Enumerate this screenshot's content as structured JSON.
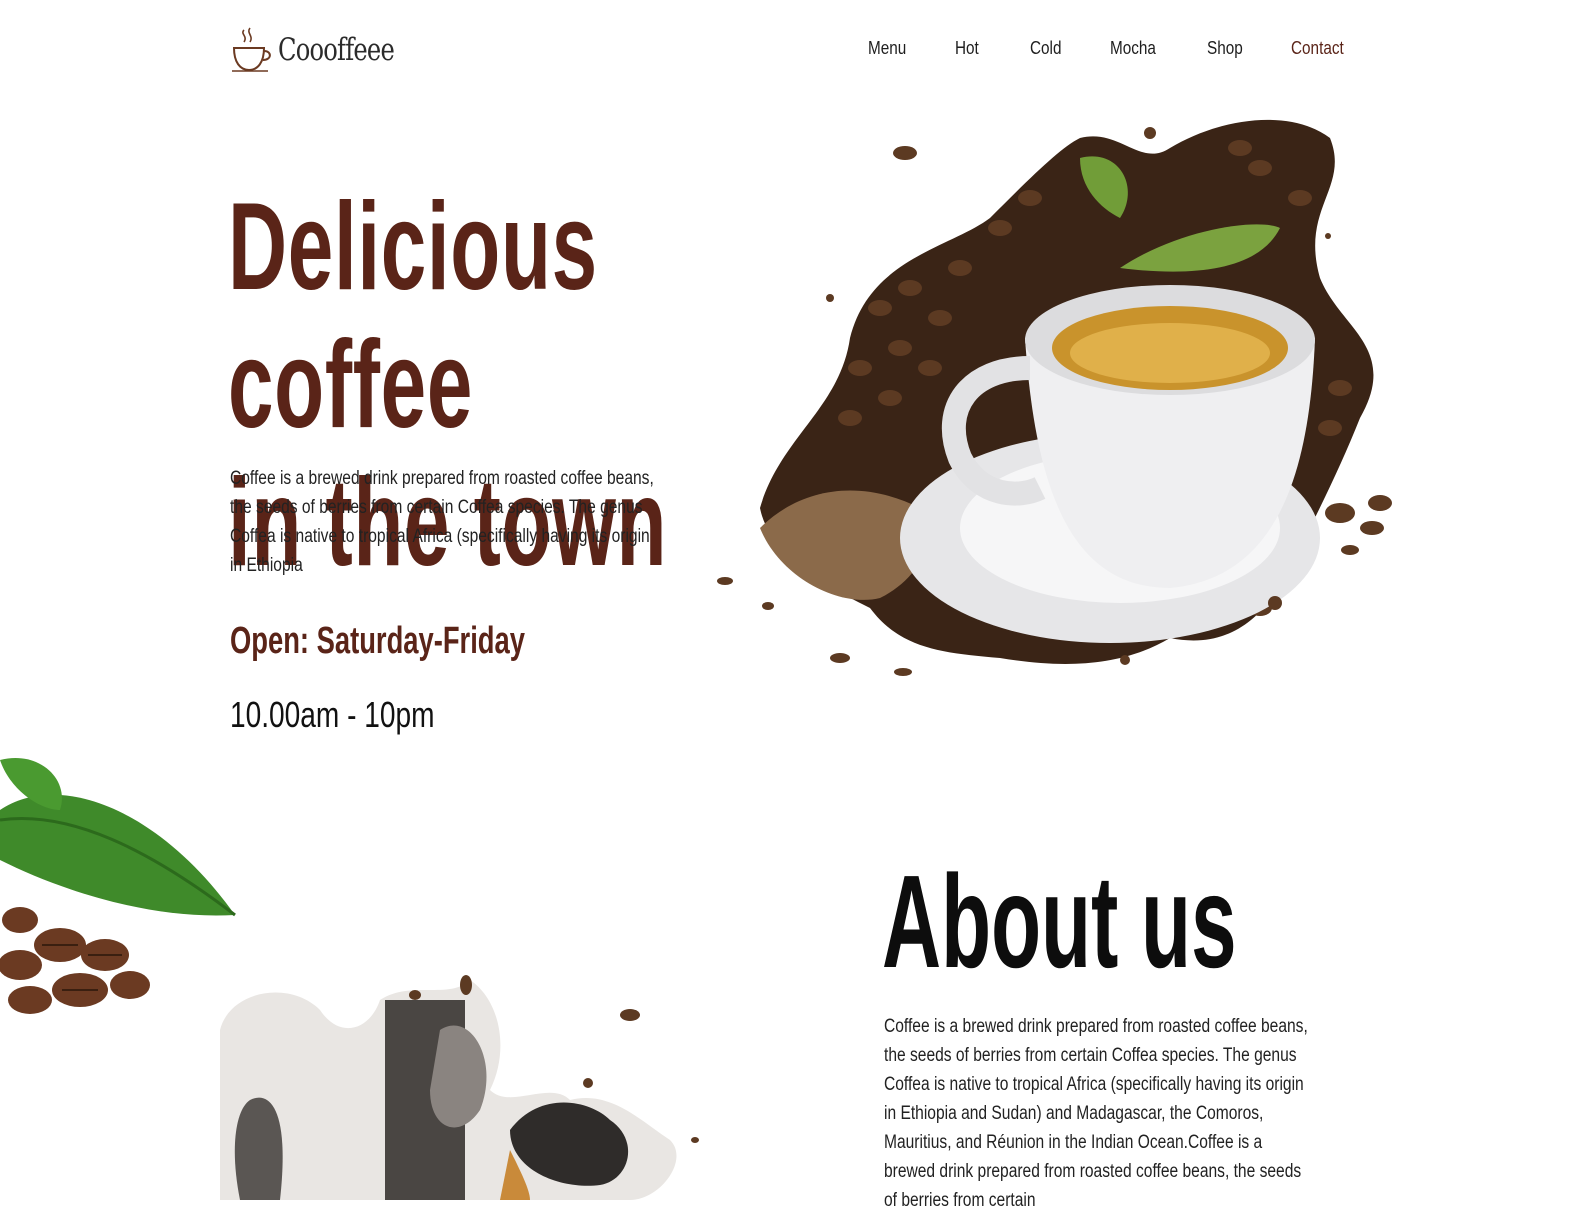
{
  "header": {
    "logo_text": "Coooffeee",
    "logo_icon": "coffee-cup-icon",
    "nav": [
      {
        "label": "Menu"
      },
      {
        "label": "Hot"
      },
      {
        "label": "Cold"
      },
      {
        "label": "Mocha"
      },
      {
        "label": "Shop"
      },
      {
        "label": "Contact",
        "active": true
      }
    ]
  },
  "hero": {
    "title_line1": "Delicious coffee",
    "title_line2": "in the town",
    "description": "Coffee is a brewed drink prepared from roasted coffee beans, the seeds of berries from certain Coffea species. The genus Coffea is native to tropical Africa (specifically having its origin in Ethiopia",
    "hours_title": "Open: Saturday-Friday",
    "hours_time": "10.00am - 10pm"
  },
  "about": {
    "title": "About us",
    "description": "Coffee is a brewed drink prepared from roasted coffee beans, the seeds of berries from certain Coffea species. The genus Coffea is native to tropical Africa (specifically having its origin in Ethiopia and Sudan) and Madagascar, the Comoros, Mauritius, and Réunion in the Indian Ocean.Coffee is a brewed drink prepared from roasted coffee beans, the seeds of berries from certain"
  },
  "colors": {
    "brand_brown": "#5a2418",
    "text_dark": "#1e1e1e",
    "background": "#ffffff"
  }
}
